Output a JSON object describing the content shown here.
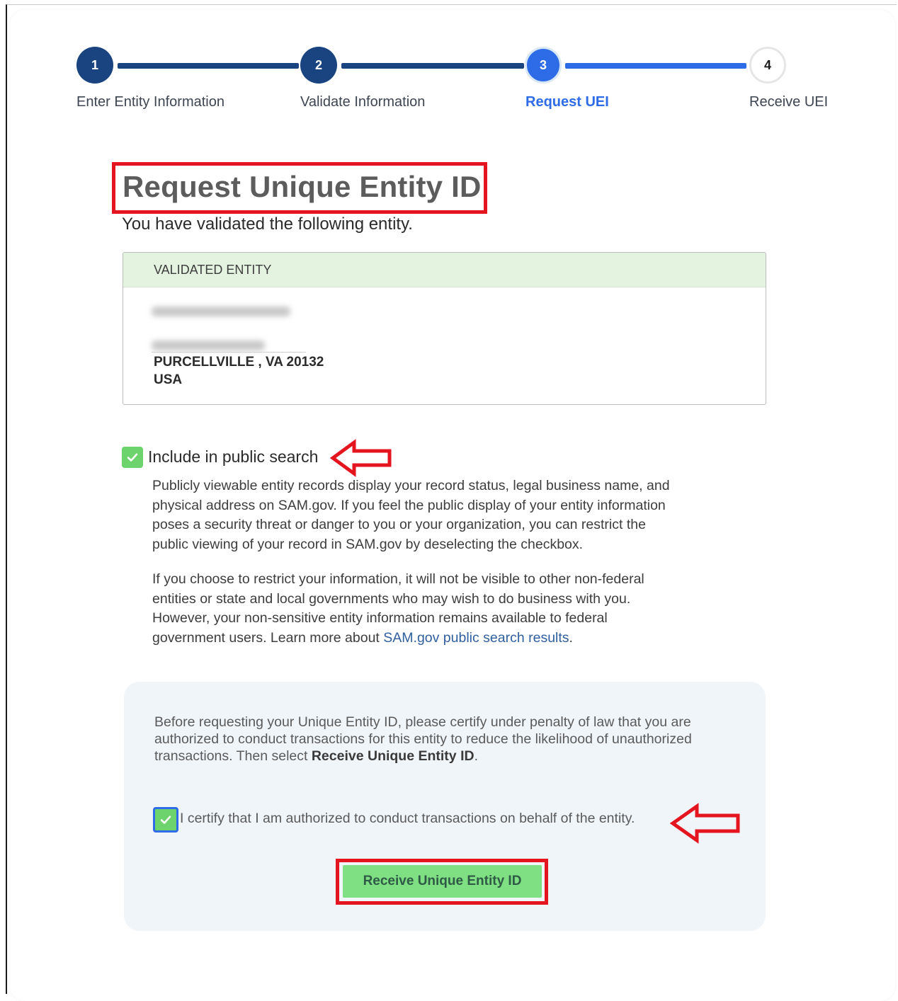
{
  "stepper": {
    "steps": [
      {
        "number": "1",
        "label": "Enter Entity Information"
      },
      {
        "number": "2",
        "label": "Validate Information"
      },
      {
        "number": "3",
        "label": "Request UEI"
      },
      {
        "number": "4",
        "label": "Receive UEI"
      }
    ],
    "current_step": 3
  },
  "page": {
    "title": "Request Unique Entity ID",
    "subtitle": "You have validated the following entity."
  },
  "entity": {
    "header": "VALIDATED ENTITY",
    "city_state_zip": "PURCELLVILLE , VA 20132",
    "country": "USA"
  },
  "public_search": {
    "checked": true,
    "label": "Include in public search",
    "paragraph1": "Publicly viewable entity records display your record status, legal business name, and physical address on SAM.gov. If you feel the public display of your entity information poses a security threat or danger to you or your organization, you can restrict the public viewing of your record in SAM.gov by deselecting the checkbox.",
    "paragraph2_text": "If you choose to restrict your information, it will not be visible to other non-federal entities or state and local governments who may wish to do business with you. However, your non-sensitive entity information remains available to federal government users. Learn more about ",
    "paragraph2_link": "SAM.gov public search results",
    "paragraph2_end": "."
  },
  "certification": {
    "text_before": "Before requesting your Unique Entity ID, please certify under penalty of law that you are authorized to conduct transactions for this entity to reduce the likelihood of unauthorized transactions. Then select ",
    "text_bold": "Receive Unique Entity ID",
    "text_after": ".",
    "checked": true,
    "checkbox_label": "I certify that I am authorized to conduct transactions on behalf of the entity."
  },
  "button": {
    "label": "Receive Unique Entity ID"
  },
  "colors": {
    "step_complete": "#1a4480",
    "step_current": "#2e6be6",
    "checkbox": "#6dd36c",
    "highlight": "#e4151f",
    "button_bg": "#7ee083"
  },
  "icons": {
    "checkbox": "check-icon",
    "annotation": "arrow-left-icon"
  }
}
